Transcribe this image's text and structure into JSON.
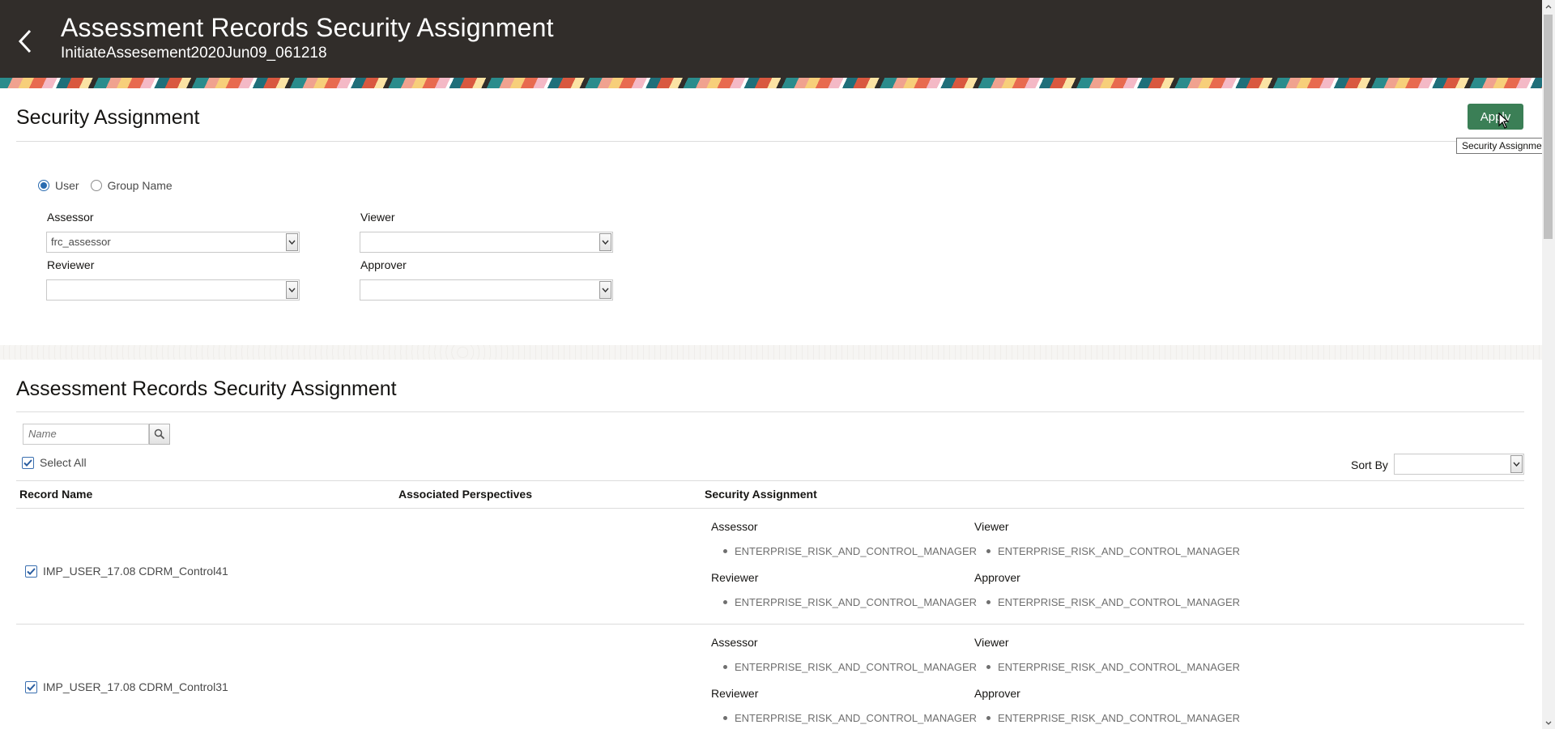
{
  "header": {
    "title": "Assessment Records Security Assignment",
    "subtitle": "InitiateAssesement2020Jun09_061218"
  },
  "security_panel": {
    "title": "Security Assignment",
    "apply_label": "Apply",
    "tooltip": "Security Assignment",
    "radio_options": [
      {
        "label": "User",
        "selected": true
      },
      {
        "label": "Group Name",
        "selected": false
      }
    ],
    "fields": {
      "assessor": {
        "label": "Assessor",
        "value": "frc_assessor"
      },
      "viewer": {
        "label": "Viewer",
        "value": ""
      },
      "reviewer": {
        "label": "Reviewer",
        "value": ""
      },
      "approver": {
        "label": "Approver",
        "value": ""
      }
    }
  },
  "records": {
    "title": "Assessment Records Security Assignment",
    "search_placeholder": "Name",
    "select_all_label": "Select All",
    "sort_by_label": "Sort By",
    "sort_by_value": "",
    "columns": [
      "Record Name",
      "Associated Perspectives",
      "Security Assignment"
    ],
    "rows": [
      {
        "name": "IMP_USER_17.08 CDRM_Control41",
        "checked": true,
        "assessor_label": "Assessor",
        "assessor_value": "ENTERPRISE_RISK_AND_CONTROL_MANAGER",
        "viewer_label": "Viewer",
        "viewer_value": "ENTERPRISE_RISK_AND_CONTROL_MANAGER",
        "reviewer_label": "Reviewer",
        "reviewer_value": "ENTERPRISE_RISK_AND_CONTROL_MANAGER",
        "approver_label": "Approver",
        "approver_value": "ENTERPRISE_RISK_AND_CONTROL_MANAGER"
      },
      {
        "name": "IMP_USER_17.08 CDRM_Control31",
        "checked": true,
        "assessor_label": "Assessor",
        "assessor_value": "ENTERPRISE_RISK_AND_CONTROL_MANAGER",
        "viewer_label": "Viewer",
        "viewer_value": "ENTERPRISE_RISK_AND_CONTROL_MANAGER",
        "reviewer_label": "Reviewer",
        "reviewer_value": "ENTERPRISE_RISK_AND_CONTROL_MANAGER",
        "approver_label": "Approver",
        "approver_value": "ENTERPRISE_RISK_AND_CONTROL_MANAGER"
      }
    ]
  },
  "colors": {
    "header_bg": "#312d2a",
    "apply_bg": "#3b7f56",
    "accent": "#2a6bb0"
  },
  "icons": [
    "back-arrow-icon",
    "chevron-down-icon",
    "search-icon",
    "checkbox-checked-icon",
    "mouse-cursor-icon"
  ]
}
